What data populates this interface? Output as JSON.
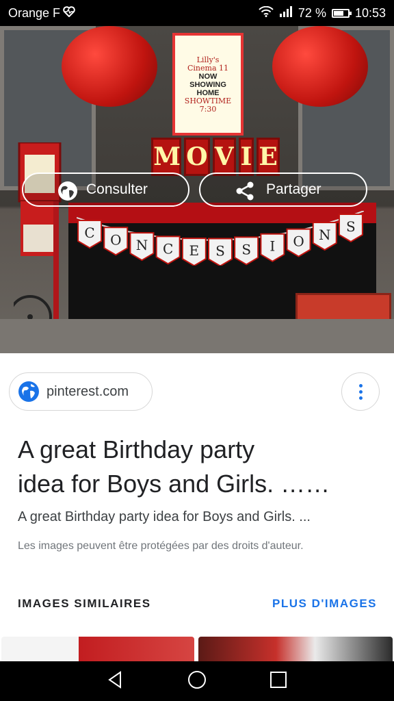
{
  "status_bar": {
    "carrier": "Orange F",
    "battery_percent": "72 %",
    "battery_level": 0.72,
    "time": "10:53"
  },
  "hero": {
    "poster": {
      "line1": "Lilly's",
      "line2": "Cinema 11",
      "line3": "NOW",
      "line4": "SHOWING",
      "line5": "HOME",
      "line6": "SHOWTIME",
      "line7": "7:30"
    },
    "marquee_letters": [
      "M",
      "O",
      "V",
      "I",
      "E"
    ],
    "banner_letters": [
      "C",
      "O",
      "N",
      "C",
      "E",
      "S",
      "S",
      "I",
      "O",
      "N",
      "S"
    ],
    "consult_label": "Consulter",
    "share_label": "Partager"
  },
  "source": {
    "domain": "pinterest.com"
  },
  "result": {
    "title_line1": "A great Birthday party",
    "title_line2": "idea for Boys and Girls. ……",
    "description": "A great Birthday party idea for Boys and Girls. ...",
    "copyright_notice": "Les images peuvent être protégées par des droits d'auteur."
  },
  "similar": {
    "section_label": "IMAGES SIMILAIRES",
    "more_label": "PLUS D'IMAGES"
  },
  "colors": {
    "accent": "#1a73e8",
    "title_text": "#202124",
    "red": "#c0140f"
  }
}
